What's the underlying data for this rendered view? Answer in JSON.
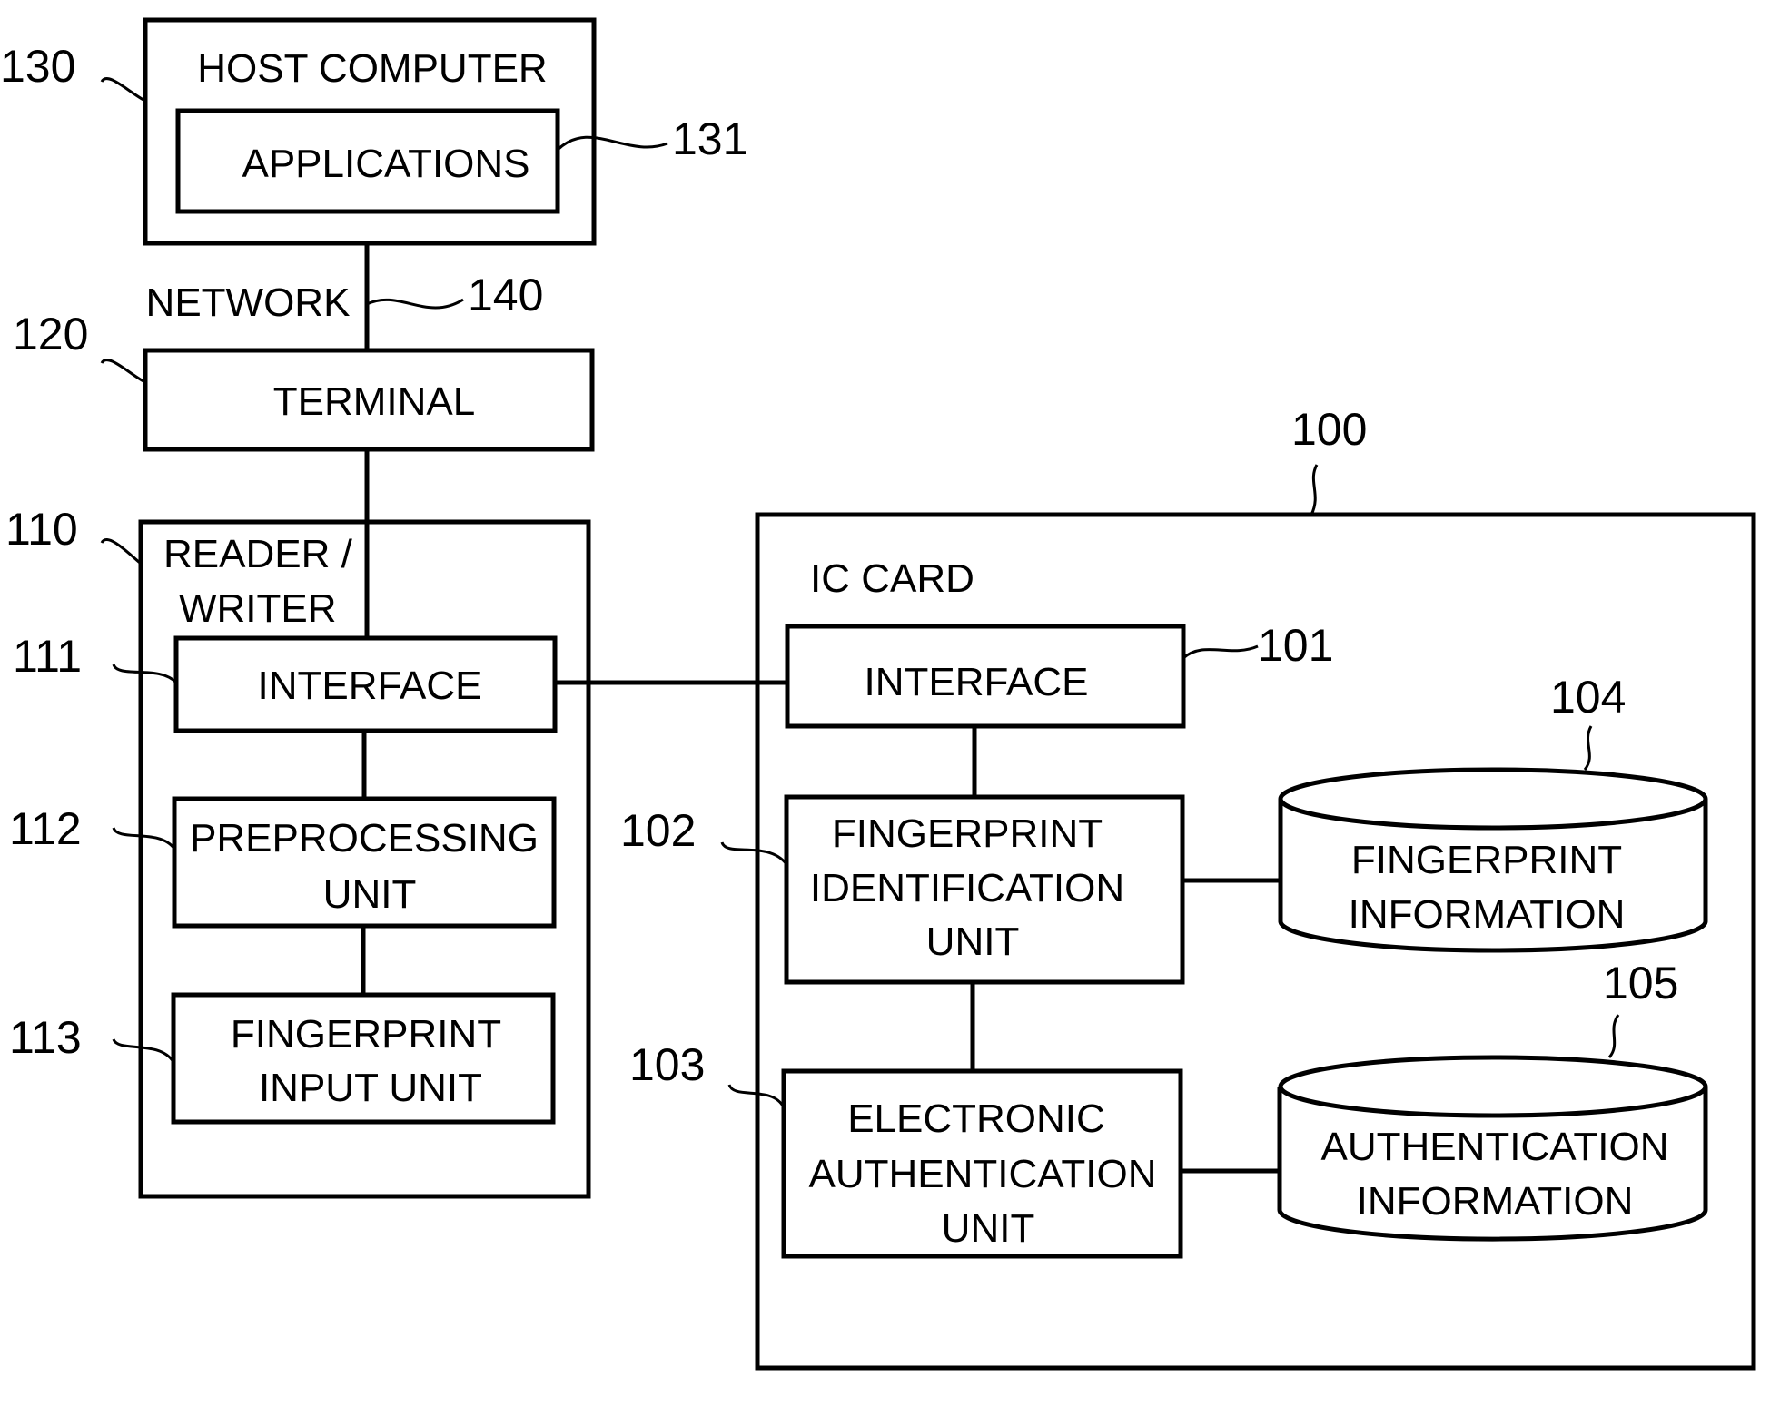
{
  "diagram": {
    "host_computer": {
      "label": "HOST COMPUTER",
      "ref": "130"
    },
    "applications": {
      "label": "APPLICATIONS",
      "ref": "131"
    },
    "network": {
      "label": "NETWORK",
      "ref": "140"
    },
    "terminal": {
      "label": "TERMINAL",
      "ref": "120"
    },
    "reader_writer": {
      "label_line1": "READER /",
      "label_line2": "WRITER",
      "ref": "110"
    },
    "rw_interface": {
      "label": "INTERFACE",
      "ref": "111"
    },
    "preprocessing": {
      "label_line1": "PREPROCESSING",
      "label_line2": "UNIT",
      "ref": "112"
    },
    "fingerprint_input": {
      "label_line1": "FINGERPRINT",
      "label_line2": "INPUT UNIT",
      "ref": "113"
    },
    "ic_card": {
      "label": "IC CARD",
      "ref": "100"
    },
    "ic_interface": {
      "label": "INTERFACE",
      "ref": "101"
    },
    "fingerprint_identification": {
      "label_line1": "FINGERPRINT",
      "label_line2": "IDENTIFICATION",
      "label_line3": "UNIT",
      "ref": "102"
    },
    "electronic_authentication": {
      "label_line1": "ELECTRONIC",
      "label_line2": "AUTHENTICATION",
      "label_line3": "UNIT",
      "ref": "103"
    },
    "fingerprint_information": {
      "label_line1": "FINGERPRINT",
      "label_line2": "INFORMATION",
      "ref": "104"
    },
    "authentication_information": {
      "label_line1": "AUTHENTICATION",
      "label_line2": "INFORMATION",
      "ref": "105"
    }
  }
}
